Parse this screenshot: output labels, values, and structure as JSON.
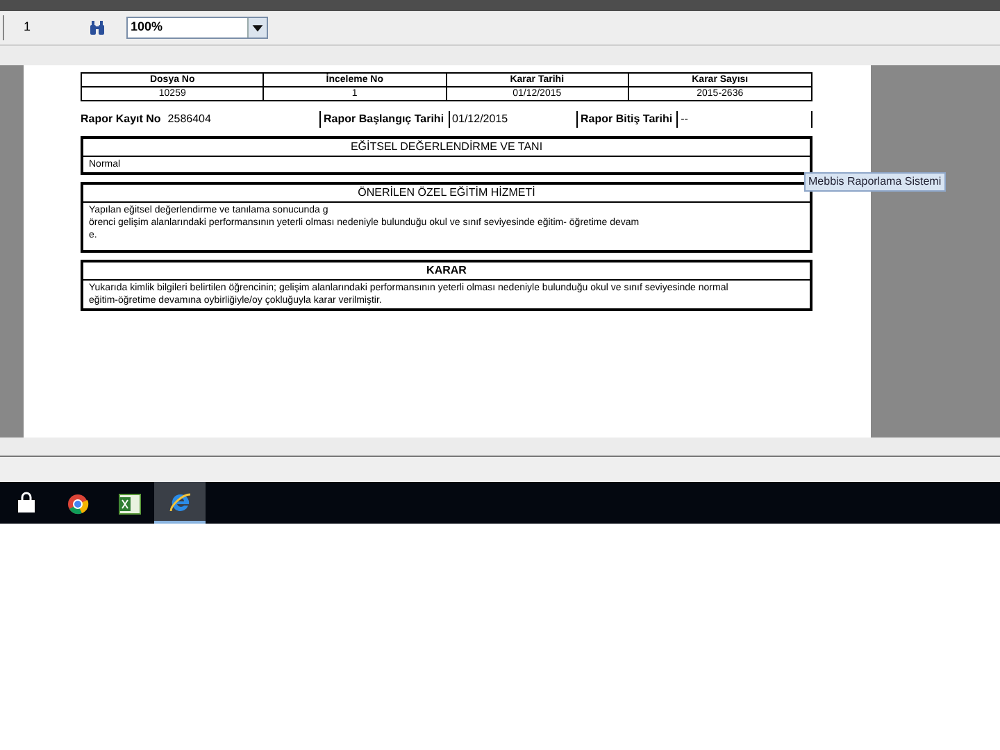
{
  "toolbar": {
    "page": "1",
    "zoom": "100%"
  },
  "header_table": {
    "columns": [
      "Dosya No",
      "İnceleme No",
      "Karar Tarihi",
      "Karar Sayısı"
    ],
    "values": [
      "10259",
      "1",
      "01/12/2015",
      "2015-2636"
    ]
  },
  "fields": [
    {
      "label": "Rapor Kayıt No",
      "value": "2586404"
    },
    {
      "label": "Rapor Başlangıç Tarihi",
      "value": "01/12/2015"
    },
    {
      "label": "Rapor Bitiş Tarihi",
      "value": "--"
    }
  ],
  "sections": [
    {
      "title": "EĞİTSEL DEĞERLENDİRME VE TANI",
      "lines": [
        "Normal"
      ]
    },
    {
      "title": "ÖNERİLEN ÖZEL EĞİTİM HİZMETİ",
      "lines": [
        "Yapılan eğitsel değerlendirme ve tanılama sonucunda g",
        "örenci gelişim alanlarındaki performansının yeterli olması nedeniyle bulunduğu okul ve sınıf seviyesinde eğitim- öğretime devam",
        "e."
      ]
    },
    {
      "title": "KARAR",
      "lines": [
        "Yukarıda kimlik bilgileri belirtilen öğrencinin; gelişim alanlarındaki performansının yeterli olması nedeniyle bulunduğu okul ve sınıf seviyesinde normal",
        "eğitim-öğretime devamına oybirliğiyle/oy çokluğuyla karar verilmiştir."
      ]
    }
  ],
  "tooltip": "Mebbis Raporlama Sistemi",
  "taskbar": [
    {
      "kind": "store",
      "selected": false
    },
    {
      "kind": "chrome",
      "selected": false
    },
    {
      "kind": "excel",
      "selected": false
    },
    {
      "kind": "ie",
      "selected": true
    }
  ]
}
